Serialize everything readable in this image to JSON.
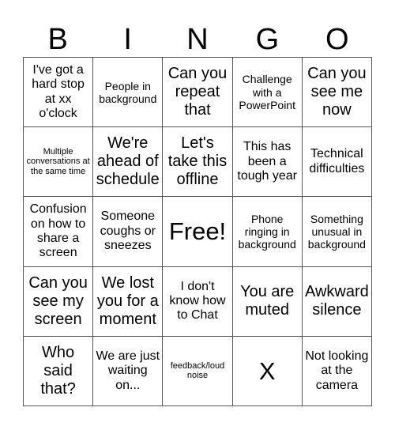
{
  "header": [
    "B",
    "I",
    "N",
    "G",
    "O"
  ],
  "cells": [
    {
      "text": "I've got a hard stop at xx o'clock",
      "size": "md"
    },
    {
      "text": "People in background",
      "size": "sm"
    },
    {
      "text": "Can you repeat that",
      "size": "lg"
    },
    {
      "text": "Challenge with a PowerPoint",
      "size": "sm"
    },
    {
      "text": "Can you see me now",
      "size": "lg"
    },
    {
      "text": "Multiple conversations at the same time",
      "size": "xs"
    },
    {
      "text": "We're ahead of schedule",
      "size": "lg"
    },
    {
      "text": "Let's take this offline",
      "size": "lg"
    },
    {
      "text": "This has been a tough year",
      "size": "md"
    },
    {
      "text": "Technical difficulties",
      "size": "md"
    },
    {
      "text": "Confusion on how to share a screen",
      "size": "md"
    },
    {
      "text": "Someone coughs or sneezes",
      "size": "md"
    },
    {
      "text": "Free!",
      "size": "xl"
    },
    {
      "text": "Phone ringing in background",
      "size": "sm"
    },
    {
      "text": "Something unusual in background",
      "size": "sm"
    },
    {
      "text": "Can you see my screen",
      "size": "lg"
    },
    {
      "text": "We lost you for a moment",
      "size": "lg"
    },
    {
      "text": "I don't know how to Chat",
      "size": "md"
    },
    {
      "text": "You are muted",
      "size": "lg"
    },
    {
      "text": "Awkward silence",
      "size": "lg"
    },
    {
      "text": "Who said that?",
      "size": "lg"
    },
    {
      "text": "We are just waiting on...",
      "size": "md"
    },
    {
      "text": "feedback/loud noise",
      "size": "xs"
    },
    {
      "text": "X",
      "size": "xl"
    },
    {
      "text": "Not looking at the camera",
      "size": "md"
    }
  ]
}
